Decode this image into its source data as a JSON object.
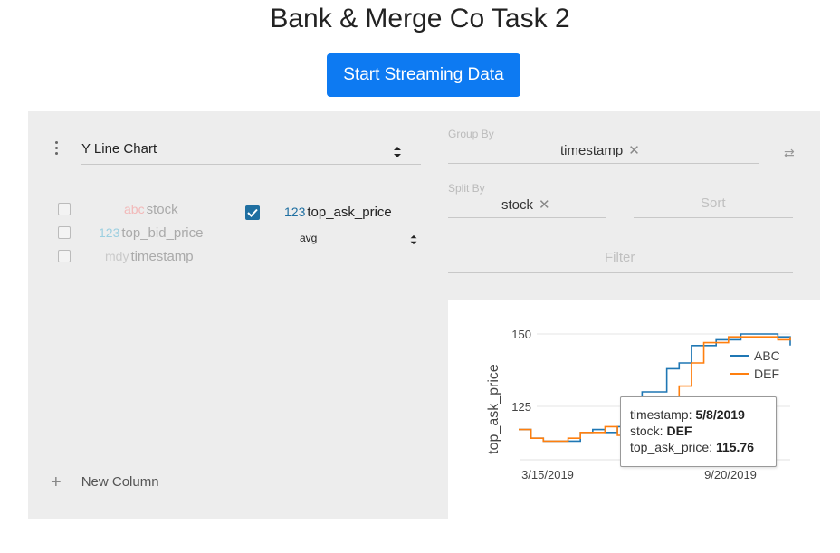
{
  "page": {
    "title": "Bank & Merge Co Task 2",
    "stream_button": "Start Streaming Data"
  },
  "config": {
    "plugin": "Y Line Chart",
    "inactive_columns": [
      {
        "type": "abc",
        "name": "stock"
      },
      {
        "type": "123",
        "name": "top_bid_price"
      },
      {
        "type": "mdy",
        "name": "timestamp"
      }
    ],
    "active_column": {
      "type": "123",
      "name": "top_ask_price",
      "aggregate": "avg"
    },
    "new_column": "New Column",
    "group_by": {
      "label": "Group By",
      "value": "timestamp"
    },
    "split_by": {
      "label": "Split By",
      "value": "stock"
    },
    "sort_placeholder": "Sort",
    "filter_placeholder": "Filter"
  },
  "chart_data": {
    "type": "line",
    "ylabel": "top_ask_price",
    "yticks": [
      "150",
      "125"
    ],
    "xticks": [
      "3/15/2019",
      "9/20/2019"
    ],
    "legend": [
      "ABC",
      "DEF"
    ],
    "colors": {
      "ABC": "#1f77b4",
      "DEF": "#ff7f0e"
    },
    "series": [
      {
        "name": "ABC",
        "values": [
          117,
          114,
          113,
          113,
          113,
          116,
          117,
          116,
          118,
          118,
          130,
          130,
          138,
          140,
          146,
          146,
          148,
          148,
          150,
          150,
          150,
          149,
          146
        ]
      },
      {
        "name": "DEF",
        "values": [
          117,
          114,
          113,
          113,
          114,
          116,
          116,
          118,
          115,
          122,
          127,
          128,
          126,
          132,
          140,
          147,
          147,
          149,
          149,
          149,
          149,
          148,
          149
        ]
      }
    ],
    "tooltip": {
      "timestamp_label": "timestamp: ",
      "timestamp": "5/8/2019",
      "stock_label": "stock: ",
      "stock": "DEF",
      "price_label": "top_ask_price: ",
      "price": "115.76"
    }
  }
}
